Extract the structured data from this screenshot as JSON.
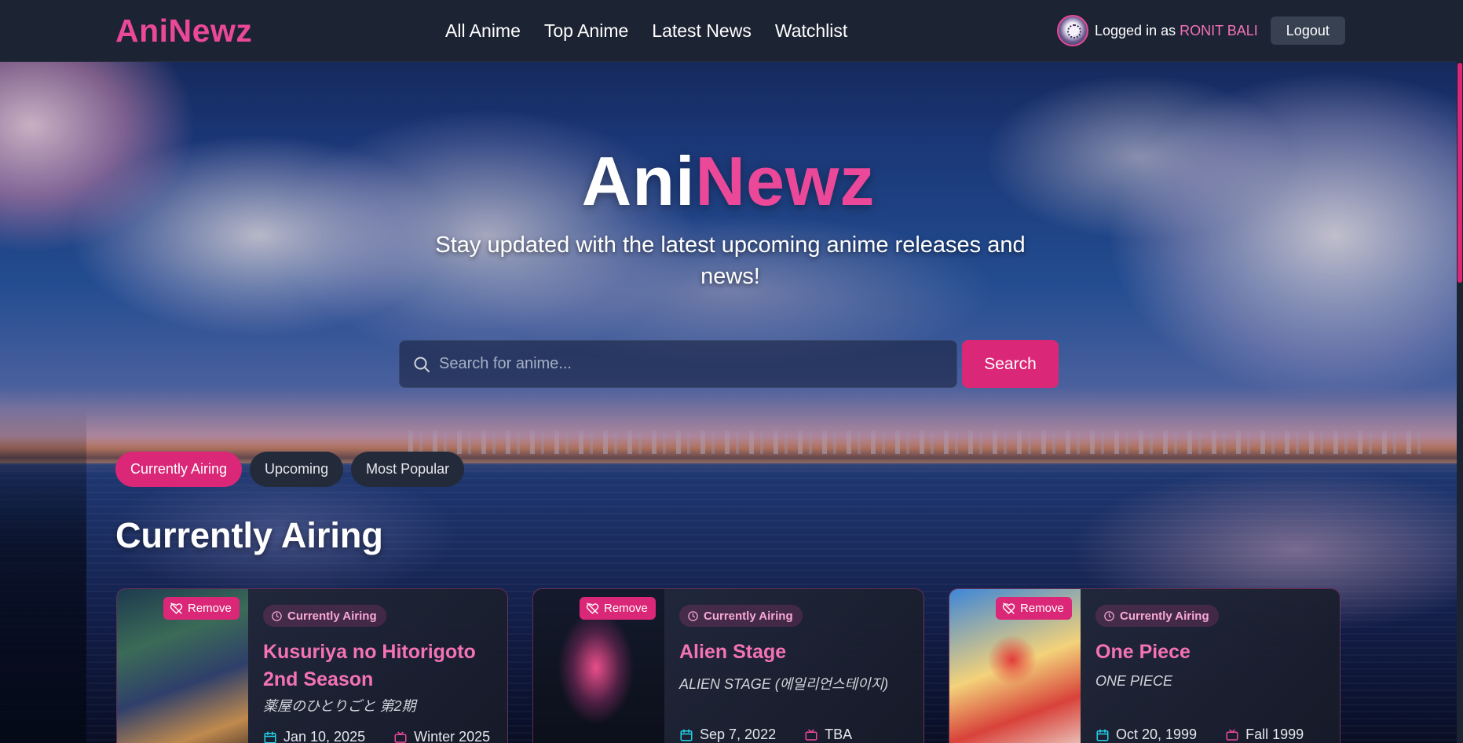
{
  "nav": {
    "brand": "AniNewz",
    "links": [
      "All Anime",
      "Top Anime",
      "Latest News",
      "Watchlist"
    ],
    "logged_in_prefix": "Logged in as",
    "username": "RONIT BALI",
    "logout_label": "Logout"
  },
  "hero": {
    "title_part1": "Ani",
    "title_part2": "Newz",
    "subtitle": "Stay updated with the latest upcoming anime releases and news!",
    "search_placeholder": "Search for anime...",
    "search_label": "Search"
  },
  "tabs": [
    "Currently Airing",
    "Upcoming",
    "Most Popular"
  ],
  "active_tab": "Currently Airing",
  "section_title": "Currently Airing",
  "cards": [
    {
      "remove_label": "Remove",
      "status": "Currently Airing",
      "title": "Kusuriya no Hitorigoto 2nd Season",
      "alt_title": "薬屋のひとりごと 第2期",
      "date": "Jan 10, 2025",
      "season": "Winter 2025"
    },
    {
      "remove_label": "Remove",
      "status": "Currently Airing",
      "title": "Alien Stage",
      "alt_title": "ALIEN STAGE (에일리언스테이지)",
      "date": "Sep 7, 2022",
      "season": "TBA"
    },
    {
      "remove_label": "Remove",
      "status": "Currently Airing",
      "title": "One Piece",
      "alt_title": "ONE PIECE",
      "date": "Oct 20, 1999",
      "season": "Fall 1999"
    }
  ],
  "colors": {
    "accent": "#ec4899",
    "button": "#db2777",
    "nav_bg": "#1c2333",
    "date_icon": "#22d3ee"
  },
  "icons": {
    "search": "search-icon",
    "remove": "heart-off-icon",
    "status": "clock-icon",
    "date": "calendar-icon",
    "season": "tv-icon"
  }
}
